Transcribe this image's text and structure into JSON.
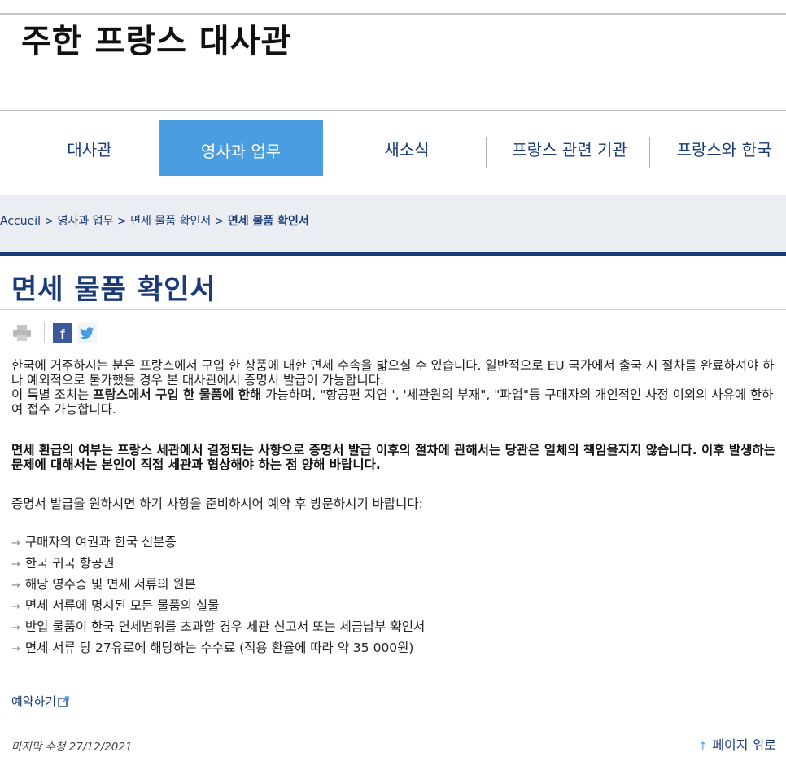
{
  "site": {
    "title": "주한 프랑스 대사관"
  },
  "nav": {
    "items": [
      {
        "label": "대사관"
      },
      {
        "label": "영사과 업무"
      },
      {
        "label": "새소식"
      },
      {
        "label": "프랑스 관련 기관"
      },
      {
        "label": "프랑스와 한국"
      }
    ],
    "active_index": 1,
    "active_color": "#4a9de0"
  },
  "breadcrumb": {
    "items": [
      "Accueil",
      "영사과 업무",
      "면세 물품 확인서"
    ],
    "separator": ">",
    "current": "면세 물품 확인서"
  },
  "page": {
    "title": "면세 물품 확인서"
  },
  "share": {
    "icons": [
      "print-icon",
      "facebook-icon",
      "twitter-icon"
    ],
    "facebook_letter": "f"
  },
  "content": {
    "para1": "한국에 거주하시는 분은 프랑스에서 구입 한 상품에 대한 면세 수속을 밟으실 수 있습니다. 일반적으로 EU 국가에서 출국 시 절차를 완료하셔야 하나 예외적으로 불가했을 경우 본 대사관에서 증명서 발급이 가능합니다.",
    "para2_prefix": "이 특별 조치는 ",
    "para2_bold": "프랑스에서 구입 한 물품에 한해",
    "para2_suffix": " 가능하며, \"항공편 지연 ', '세관원의 부재\", \"파업\"등 구매자의 개인적인 사정 이외의 사유에 한하여 접수 가능합니다.",
    "warning": "면세 환급의 여부는 프랑스 세관에서 결정되는 사항으로 증명서 발급 이후의 절차에 관해서는 당관은 일체의 책임을지지 않습니다. 이후 발생하는 문제에 대해서는 본인이 직접 세관과 협상해야 하는 점 양해 바랍니다.",
    "intro": "증명서 발급을 원하시면 하기 사항을 준비하시어 예약 후 방문하시기 바랍니다:",
    "list_marker": "→",
    "list": [
      "구매자의 여권과 한국 신분증",
      "한국 귀국 항공권",
      "해당 영수증 및 면세 서류의 원본",
      "면세 서류에 명시된 모든 물품의 실물",
      "반입 물품이 한국 면세범위를 초과할 경우 세관 신고서 또는 세금납부 확인서",
      "면세 서류 당 27유로에 해당하는 수수료 (적용 환율에 따라 약 35 000원)"
    ]
  },
  "booking": {
    "label": "예약하기",
    "icon": "external-link-icon"
  },
  "footer": {
    "updated": "마지막 수정 27/12/2021",
    "back_to_top": "페이지 위로",
    "back_to_top_icon": "arrow-up-icon"
  }
}
